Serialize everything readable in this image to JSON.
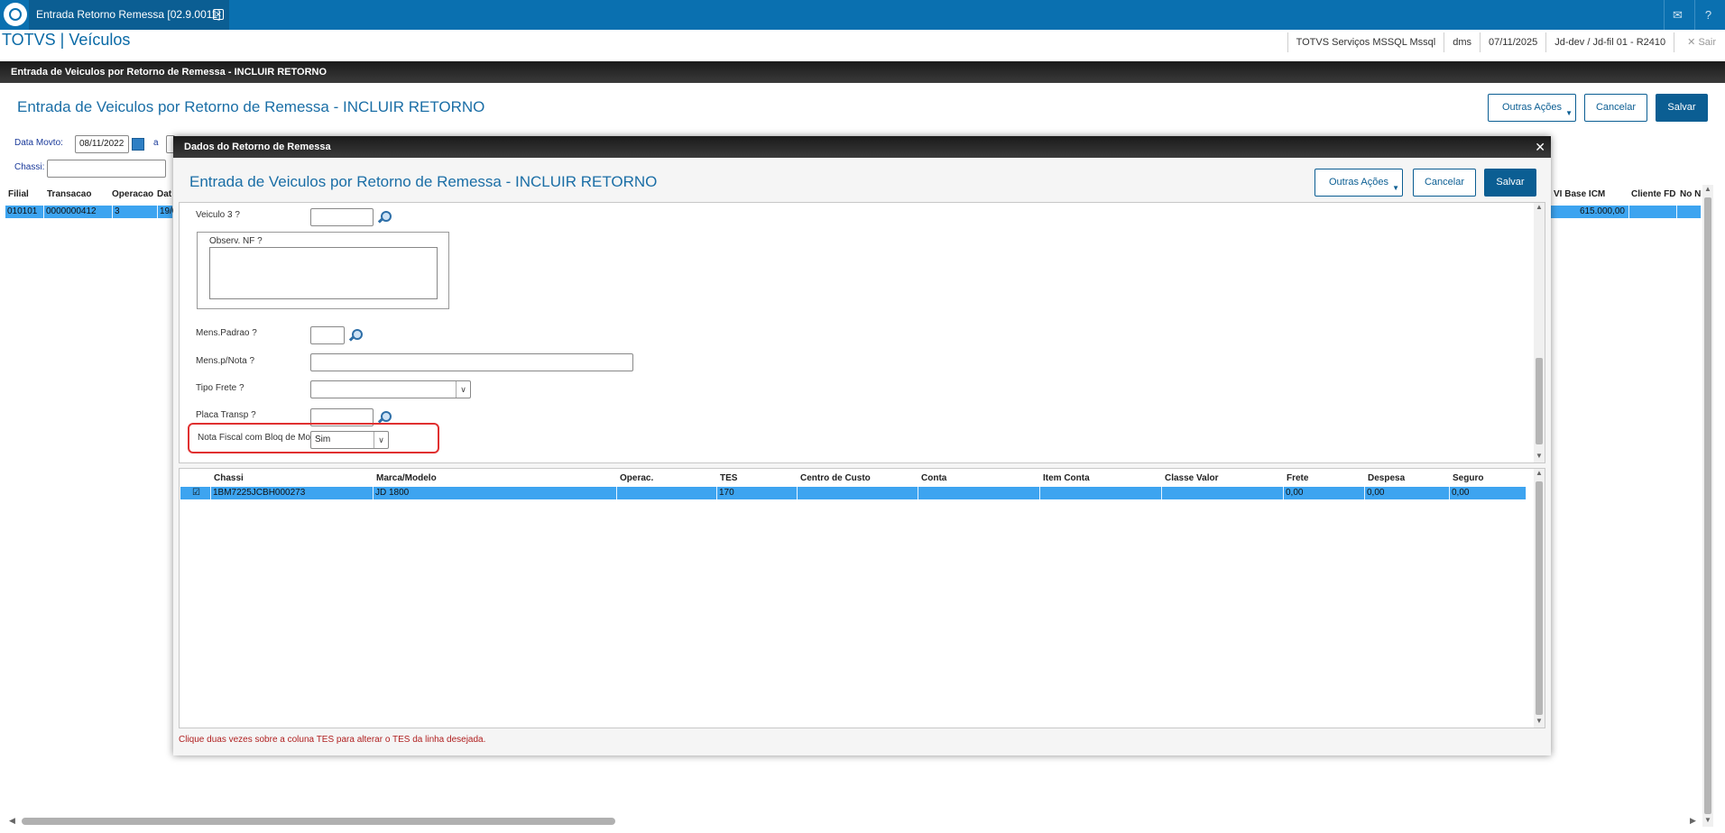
{
  "topbar": {
    "tab_title": "Entrada Retorno Remessa [02.9.0011]",
    "tab_close": "✕",
    "mail_icon": "✉",
    "help_icon": "?"
  },
  "app": {
    "title": "TOTVS | Veículos",
    "status": {
      "company": "TOTVS Serviços MSSQL Mssql",
      "env": "dms",
      "date": "07/11/2025",
      "branch": "Jd-dev / Jd-fil 01 - R2410",
      "exit": "Sair"
    }
  },
  "screen": {
    "bar_title": "Entrada de Veiculos por Retorno de Remessa - INCLUIR RETORNO",
    "page_title": "Entrada de Veiculos por Retorno de Remessa - INCLUIR RETORNO",
    "buttons": {
      "outras": "Outras Ações",
      "cancelar": "Cancelar",
      "salvar": "Salvar"
    },
    "filters": {
      "data_movto_label": "Data Movto:",
      "data_movto_value": "08/11/2022",
      "ate_label": "a",
      "chassi_label": "Chassi:"
    },
    "grid": {
      "headers_left": [
        "Filial",
        "Transacao",
        "Operacao",
        "Dat"
      ],
      "headers_right": [
        "VI Base ICM",
        "Cliente FD",
        "No N"
      ],
      "row": {
        "filial": "010101",
        "transacao": "0000000412",
        "operacao": "3",
        "data": "19/0",
        "base_icm": "615.000,00"
      }
    }
  },
  "modal": {
    "header": "Dados do Retorno de Remessa",
    "close": "✕",
    "title": "Entrada de Veiculos por Retorno de Remessa - INCLUIR RETORNO",
    "buttons": {
      "outras": "Outras Ações",
      "cancelar": "Cancelar",
      "salvar": "Salvar"
    },
    "form": {
      "veiculo3": "Veiculo 3   ?",
      "observ": "Observ. NF   ?",
      "mens_padrao": "Mens.Padrao  ?",
      "mens_nota": "Mens.p/Nota  ?",
      "tipo_frete": "Tipo Frete   ?",
      "placa_transp": "Placa Transp ?",
      "nota_bloq": "Nota Fiscal com Bloq de Mov. ?",
      "nota_bloq_value": "Sim"
    },
    "items": {
      "headers": [
        "Chassi",
        "Marca/Modelo",
        "Operac.",
        "TES",
        "Centro de Custo",
        "Conta",
        "Item Conta",
        "Classe Valor",
        "Frete",
        "Despesa",
        "Seguro"
      ],
      "rows": [
        {
          "chassi": "1BM7225JCBH000273",
          "marca": "JD 1800",
          "operac": "",
          "tes": "170",
          "centro": "",
          "conta": "",
          "item_conta": "",
          "classe": "",
          "frete": "0,00",
          "despesa": "0,00",
          "seguro": "0,00"
        }
      ]
    },
    "hint": "Clique duas vezes sobre a coluna TES para alterar o TES da linha desejada."
  }
}
